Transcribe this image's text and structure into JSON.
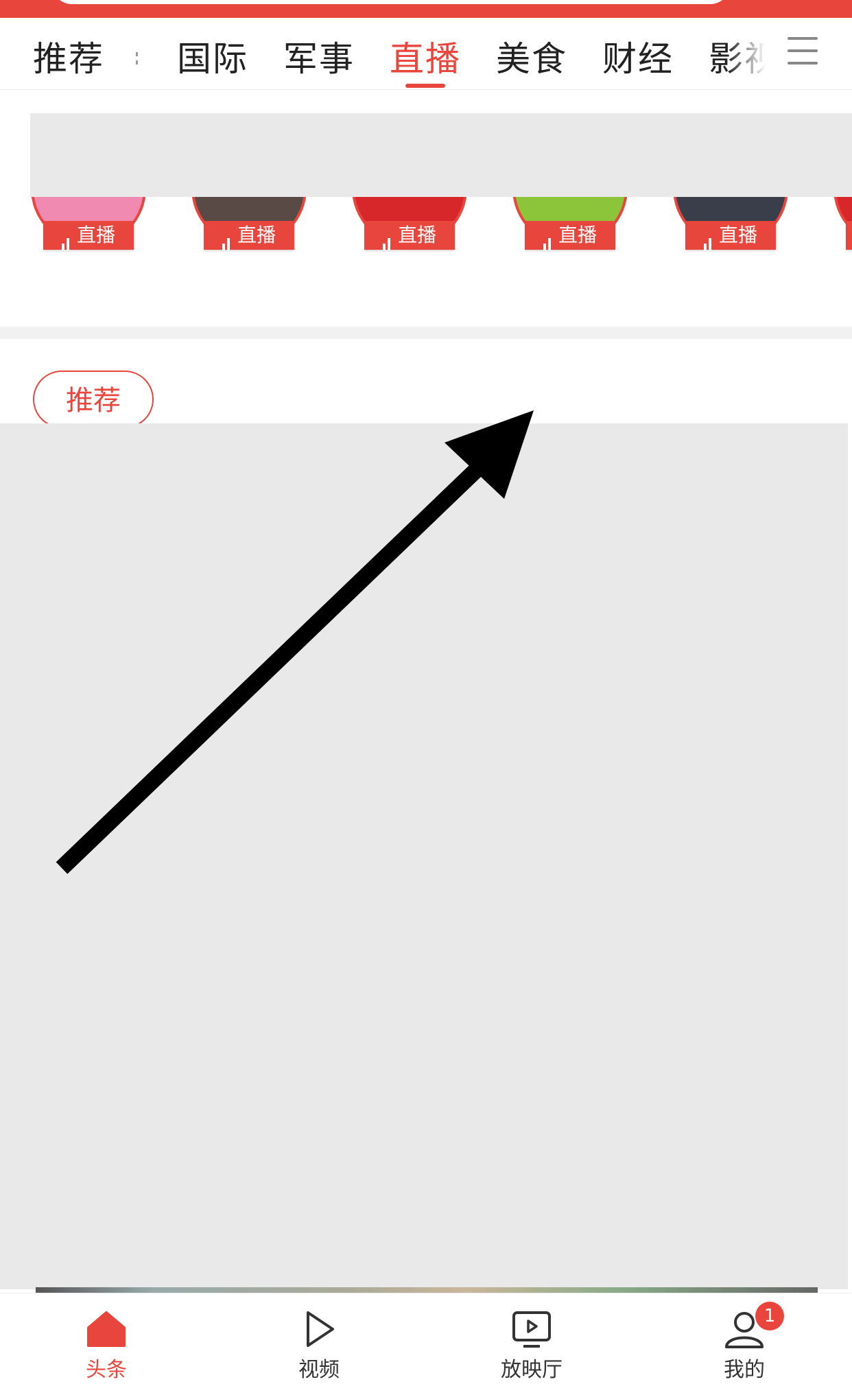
{
  "tabs": {
    "items": [
      {
        "label": "推荐"
      },
      {
        "label": "国际"
      },
      {
        "label": "军事"
      },
      {
        "label": "直播"
      },
      {
        "label": "美食"
      },
      {
        "label": "财经"
      },
      {
        "label": "影视"
      }
    ],
    "active_index": 3,
    "more_icon": "menu-icon"
  },
  "live": {
    "badge_label": "直播",
    "badge_icon": "signal-bars-icon",
    "count_visible": 6
  },
  "filter_pill": {
    "label": "推荐"
  },
  "bottom_nav": {
    "items": [
      {
        "label": "头条",
        "icon": "home-icon",
        "active": true
      },
      {
        "label": "视频",
        "icon": "play-icon",
        "active": false
      },
      {
        "label": "放映厅",
        "icon": "tv-play-icon",
        "active": false
      },
      {
        "label": "我的",
        "icon": "user-icon",
        "active": false,
        "badge": "1"
      }
    ]
  },
  "colors": {
    "accent": "#e8453c",
    "placeholder": "#e9e9e9",
    "text": "#222222"
  }
}
